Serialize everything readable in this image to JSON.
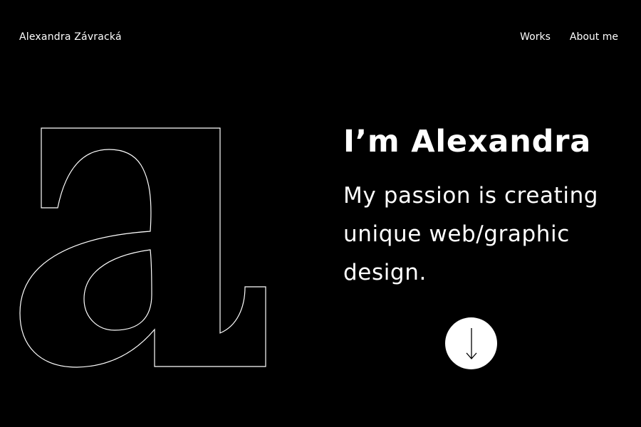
{
  "header": {
    "brand": "Alexandra Závracká",
    "nav": [
      {
        "label": "Works"
      },
      {
        "label": "About me"
      }
    ]
  },
  "hero": {
    "heading": "I’m Alexandra",
    "tagline": "My passion is creating unique web/graphic design."
  },
  "decor": {
    "letter_icon": "outline-letter-a-icon",
    "scroll_icon": "arrow-down-icon"
  },
  "colors": {
    "background": "#000000",
    "foreground": "#ffffff"
  }
}
